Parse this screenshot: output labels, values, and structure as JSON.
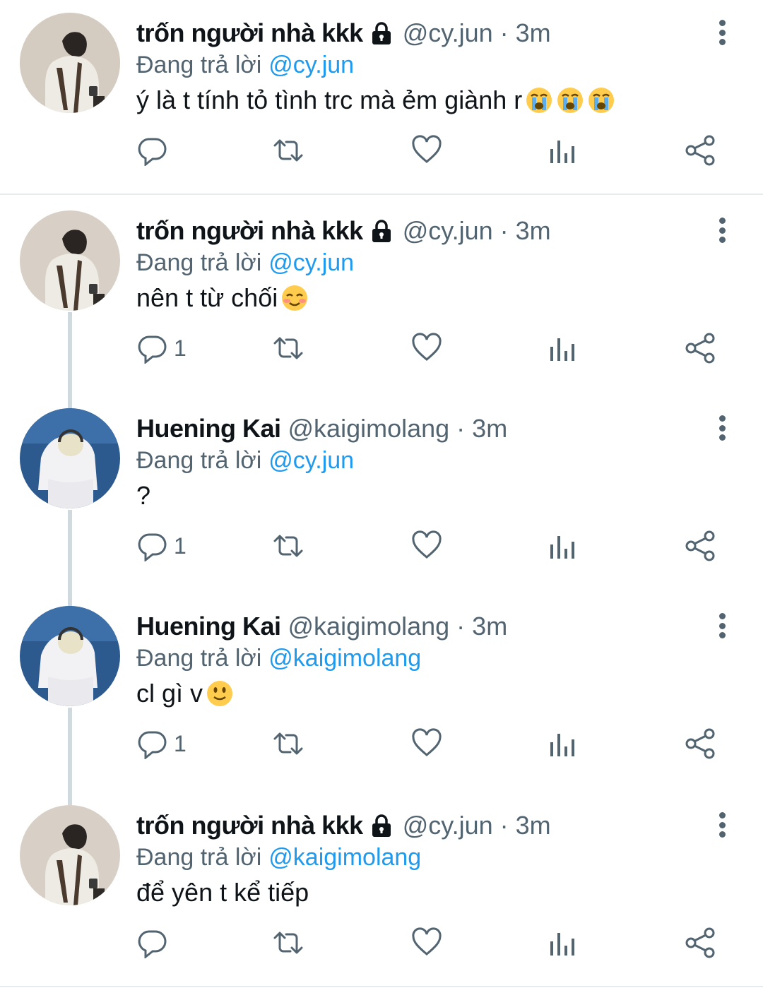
{
  "tweets": [
    {
      "name": "trốn người nhà kkk",
      "locked": true,
      "handle": "@cy.jun",
      "sep": "·",
      "time": "3m",
      "reply_prefix": "Đang trả lời",
      "reply_to": "@cy.jun",
      "text": "ý là t tính tỏ tình trc mà ẻm giành r",
      "emojis": [
        "loudly-crying-face-emoji",
        "loudly-crying-face-emoji",
        "loudly-crying-face-emoji"
      ],
      "reply_count": ""
    },
    {
      "name": "trốn người nhà kkk",
      "locked": true,
      "handle": "@cy.jun",
      "sep": "·",
      "time": "3m",
      "reply_prefix": "Đang trả lời",
      "reply_to": "@cy.jun",
      "text": "nên t từ chối",
      "emojis": [
        "smiling-face-emoji"
      ],
      "reply_count": "1"
    },
    {
      "name": "Huening Kai",
      "locked": false,
      "handle": "@kaigimolang",
      "sep": "·",
      "time": "3m",
      "reply_prefix": "Đang trả lời",
      "reply_to": "@cy.jun",
      "text": "?",
      "emojis": [],
      "reply_count": "1"
    },
    {
      "name": "Huening Kai",
      "locked": false,
      "handle": "@kaigimolang",
      "sep": "·",
      "time": "3m",
      "reply_prefix": "Đang trả lời",
      "reply_to": "@kaigimolang",
      "text": "cl gì v",
      "emojis": [
        "slightly-smiling-face-emoji"
      ],
      "reply_count": "1"
    },
    {
      "name": "trốn người nhà kkk",
      "locked": true,
      "handle": "@cy.jun",
      "sep": "·",
      "time": "3m",
      "reply_prefix": "Đang trả lời",
      "reply_to": "@kaigimolang",
      "text": "để yên t kể tiếp",
      "emojis": [],
      "reply_count": ""
    }
  ],
  "icons": {
    "reply": "reply-icon",
    "retweet": "retweet-icon",
    "like": "heart-icon",
    "analytics": "analytics-icon",
    "share": "share-icon",
    "more": "more-options-icon",
    "lock": "lock-icon"
  },
  "colors": {
    "link": "#1d9bf0",
    "secondary": "#536471",
    "thread_line": "#cfd9de"
  }
}
